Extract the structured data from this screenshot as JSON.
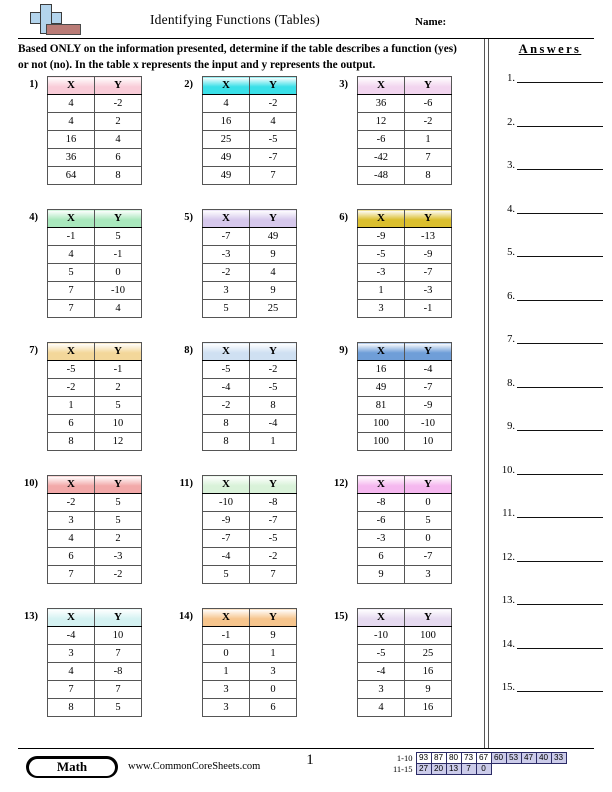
{
  "header": {
    "title": "Identifying Functions (Tables)",
    "name_label": "Name:",
    "logo_icon": "math-plus-logo-icon"
  },
  "instructions": "Based ONLY on the information presented, determine if the table describes a function (yes) or not (no). In the table x represents the input and y represents the output.",
  "answers": {
    "title": "Answers",
    "items": [
      {
        "num": "1."
      },
      {
        "num": "2."
      },
      {
        "num": "3."
      },
      {
        "num": "4."
      },
      {
        "num": "5."
      },
      {
        "num": "6."
      },
      {
        "num": "7."
      },
      {
        "num": "8."
      },
      {
        "num": "9."
      },
      {
        "num": "10."
      },
      {
        "num": "11."
      },
      {
        "num": "12."
      },
      {
        "num": "13."
      },
      {
        "num": "14."
      },
      {
        "num": "15."
      }
    ]
  },
  "columns": {
    "x": "X",
    "y": "Y"
  },
  "problems": [
    {
      "num": "1)",
      "header_color": "#f9ccd8",
      "rows": [
        [
          "4",
          "-2"
        ],
        [
          "4",
          "2"
        ],
        [
          "16",
          "4"
        ],
        [
          "36",
          "6"
        ],
        [
          "64",
          "8"
        ]
      ]
    },
    {
      "num": "2)",
      "header_color": "#3ae0e8",
      "rows": [
        [
          "4",
          "-2"
        ],
        [
          "16",
          "4"
        ],
        [
          "25",
          "-5"
        ],
        [
          "49",
          "-7"
        ],
        [
          "49",
          "7"
        ]
      ]
    },
    {
      "num": "3)",
      "header_color": "#f2d5ef",
      "rows": [
        [
          "36",
          "-6"
        ],
        [
          "12",
          "-2"
        ],
        [
          "-6",
          "1"
        ],
        [
          "-42",
          "7"
        ],
        [
          "-48",
          "8"
        ]
      ]
    },
    {
      "num": "4)",
      "header_color": "#a9e8bd",
      "rows": [
        [
          "-1",
          "5"
        ],
        [
          "4",
          "-1"
        ],
        [
          "5",
          "0"
        ],
        [
          "7",
          "-10"
        ],
        [
          "7",
          "4"
        ]
      ]
    },
    {
      "num": "5)",
      "header_color": "#d6c8ec",
      "rows": [
        [
          "-7",
          "49"
        ],
        [
          "-3",
          "9"
        ],
        [
          "-2",
          "4"
        ],
        [
          "3",
          "9"
        ],
        [
          "5",
          "25"
        ]
      ]
    },
    {
      "num": "6)",
      "header_color": "#dbbf2e",
      "rows": [
        [
          "-9",
          "-13"
        ],
        [
          "-5",
          "-9"
        ],
        [
          "-3",
          "-7"
        ],
        [
          "1",
          "-3"
        ],
        [
          "3",
          "-1"
        ]
      ]
    },
    {
      "num": "7)",
      "header_color": "#f3d79a",
      "rows": [
        [
          "-5",
          "-1"
        ],
        [
          "-2",
          "2"
        ],
        [
          "1",
          "5"
        ],
        [
          "6",
          "10"
        ],
        [
          "8",
          "12"
        ]
      ]
    },
    {
      "num": "8)",
      "header_color": "#cfe0f2",
      "rows": [
        [
          "-5",
          "-2"
        ],
        [
          "-4",
          "-5"
        ],
        [
          "-2",
          "8"
        ],
        [
          "8",
          "-4"
        ],
        [
          "8",
          "1"
        ]
      ]
    },
    {
      "num": "9)",
      "header_color": "#6f9ed8",
      "rows": [
        [
          "16",
          "-4"
        ],
        [
          "49",
          "-7"
        ],
        [
          "81",
          "-9"
        ],
        [
          "100",
          "-10"
        ],
        [
          "100",
          "10"
        ]
      ]
    },
    {
      "num": "10)",
      "header_color": "#f2a9a9",
      "rows": [
        [
          "-2",
          "5"
        ],
        [
          "3",
          "5"
        ],
        [
          "4",
          "2"
        ],
        [
          "6",
          "-3"
        ],
        [
          "7",
          "-2"
        ]
      ]
    },
    {
      "num": "11)",
      "header_color": "#d9f2d9",
      "rows": [
        [
          "-10",
          "-8"
        ],
        [
          "-9",
          "-7"
        ],
        [
          "-7",
          "-5"
        ],
        [
          "-4",
          "-2"
        ],
        [
          "5",
          "7"
        ]
      ]
    },
    {
      "num": "12)",
      "header_color": "#f5b8ef",
      "rows": [
        [
          "-8",
          "0"
        ],
        [
          "-6",
          "5"
        ],
        [
          "-3",
          "0"
        ],
        [
          "6",
          "-7"
        ],
        [
          "9",
          "3"
        ]
      ]
    },
    {
      "num": "13)",
      "header_color": "#d5f2f2",
      "rows": [
        [
          "-4",
          "10"
        ],
        [
          "3",
          "7"
        ],
        [
          "4",
          "-8"
        ],
        [
          "7",
          "7"
        ],
        [
          "8",
          "5"
        ]
      ]
    },
    {
      "num": "14)",
      "header_color": "#f6c58d",
      "rows": [
        [
          "-1",
          "9"
        ],
        [
          "0",
          "1"
        ],
        [
          "1",
          "3"
        ],
        [
          "3",
          "0"
        ],
        [
          "3",
          "6"
        ]
      ]
    },
    {
      "num": "15)",
      "header_color": "#e6daf0",
      "rows": [
        [
          "-10",
          "100"
        ],
        [
          "-5",
          "25"
        ],
        [
          "-4",
          "16"
        ],
        [
          "3",
          "9"
        ],
        [
          "4",
          "16"
        ]
      ]
    }
  ],
  "footer": {
    "subject_badge": "Math",
    "site_url": "www.CommonCoreSheets.com",
    "page_number": "1",
    "score_table": {
      "rows": [
        {
          "label": "1-10",
          "cells": [
            {
              "value": "93",
              "shaded": false
            },
            {
              "value": "87",
              "shaded": false
            },
            {
              "value": "80",
              "shaded": false
            },
            {
              "value": "73",
              "shaded": false
            },
            {
              "value": "67",
              "shaded": false
            },
            {
              "value": "60",
              "shaded": true
            },
            {
              "value": "53",
              "shaded": true
            },
            {
              "value": "47",
              "shaded": true
            },
            {
              "value": "40",
              "shaded": true
            },
            {
              "value": "33",
              "shaded": true
            }
          ]
        },
        {
          "label": "11-15",
          "cells": [
            {
              "value": "27",
              "shaded": true
            },
            {
              "value": "20",
              "shaded": true
            },
            {
              "value": "13",
              "shaded": true
            },
            {
              "value": "7",
              "shaded": true
            },
            {
              "value": "0",
              "shaded": true
            }
          ]
        }
      ]
    }
  }
}
